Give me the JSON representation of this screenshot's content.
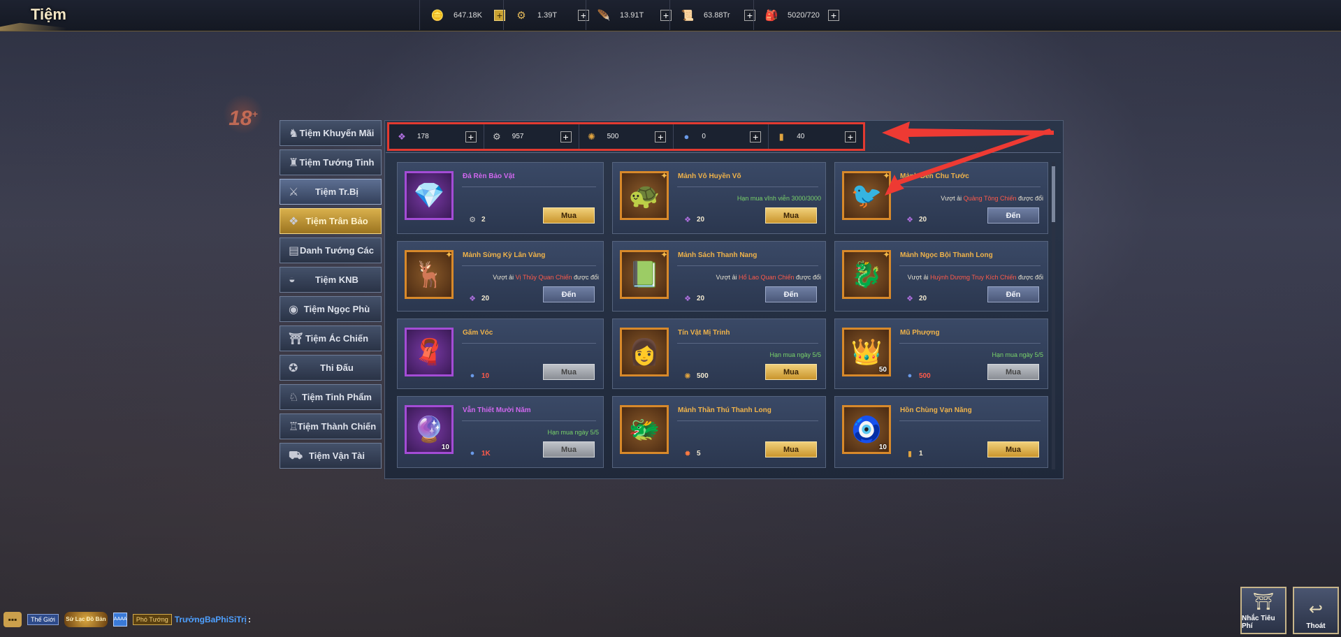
{
  "window": {
    "title": "Tiệm"
  },
  "currencies": [
    {
      "icon": "gold-ingot-icon",
      "glyph": "🪙",
      "value": "647.18K",
      "gold_plus": true
    },
    {
      "icon": "silver-coin-icon",
      "glyph": "⚙",
      "value": "1.39T",
      "gold_plus": false
    },
    {
      "icon": "feather-token-icon",
      "glyph": "🪶",
      "value": "13.91T",
      "gold_plus": false
    },
    {
      "icon": "scroll-token-icon",
      "glyph": "📜",
      "value": "63.88Tr",
      "gold_plus": false
    },
    {
      "icon": "stamina-icon",
      "glyph": "🎒",
      "value": "5020/720",
      "gold_plus": false
    }
  ],
  "age_rating": "18",
  "sidebar": {
    "items": [
      {
        "label": "Tiệm Khuyến Mãi",
        "icon": "horse-icon",
        "glyph": "♞",
        "state": "normal"
      },
      {
        "label": "Tiệm Tướng Tinh",
        "icon": "warrior-icon",
        "glyph": "♜",
        "state": "normal"
      },
      {
        "label": "Tiệm Tr.Bị",
        "icon": "armor-icon",
        "glyph": "⚔",
        "state": "highlight"
      },
      {
        "label": "Tiệm Trân Bảo",
        "icon": "treasure-icon",
        "glyph": "❖",
        "state": "selected"
      },
      {
        "label": "Danh Tướng Các",
        "icon": "book-icon",
        "glyph": "▤",
        "state": "normal"
      },
      {
        "label": "Tiệm KNB",
        "icon": "ingot-icon",
        "glyph": "◒",
        "state": "normal"
      },
      {
        "label": "Tiệm Ngọc Phù",
        "icon": "jade-icon",
        "glyph": "◉",
        "state": "normal"
      },
      {
        "label": "Tiệm Ác Chiến",
        "icon": "pagoda-icon",
        "glyph": "⛩",
        "state": "normal"
      },
      {
        "label": "Thi Đấu",
        "icon": "medal-icon",
        "glyph": "✪",
        "state": "normal"
      },
      {
        "label": "Tiệm Tinh Phẩm",
        "icon": "camel-icon",
        "glyph": "♘",
        "state": "normal"
      },
      {
        "label": "Tiệm Thành Chiến",
        "icon": "castle-icon",
        "glyph": "♖",
        "state": "normal"
      },
      {
        "label": "Tiệm Vận Tài",
        "icon": "cart-icon",
        "glyph": "⛟",
        "state": "normal"
      }
    ]
  },
  "shop_currencies": [
    {
      "icon": "purple-gem-icon",
      "glyph": "❖",
      "color": "#b070e0",
      "value": "178"
    },
    {
      "icon": "silver-coin-icon",
      "glyph": "⚙",
      "color": "#c8c8c8",
      "value": "957"
    },
    {
      "icon": "gold-pouch-icon",
      "glyph": "✺",
      "color": "#e0a440",
      "value": "500"
    },
    {
      "icon": "blue-orb-icon",
      "glyph": "●",
      "color": "#6a9ae8",
      "value": "0"
    },
    {
      "icon": "scroll-token-icon",
      "glyph": "▮",
      "color": "#e0a440",
      "value": "40"
    }
  ],
  "items": [
    {
      "name": "Đá Rèn Bảo Vật",
      "name_color": "pu",
      "frame": "p",
      "glyph": "💎",
      "count": "",
      "star": false,
      "note_pre": "",
      "note_mid": "",
      "note_post": "",
      "note_style": "",
      "price_icon": "silver-coin-icon",
      "price_glyph": "⚙",
      "price_color": "#c8c8c8",
      "price": "2",
      "price_red": false,
      "button": "Mua",
      "button_type": "buy"
    },
    {
      "name": "Mảnh Vô Huyền Võ",
      "name_color": "or",
      "frame": "o",
      "glyph": "🐢",
      "count": "",
      "star": true,
      "note_pre": "Hạn mua vĩnh viễn 3000/3000",
      "note_mid": "",
      "note_post": "",
      "note_style": "g",
      "price_icon": "purple-gem-icon",
      "price_glyph": "❖",
      "price_color": "#b070e0",
      "price": "20",
      "price_red": false,
      "button": "Mua",
      "button_type": "buy"
    },
    {
      "name": "Mảnh Đèn Chu Tước",
      "name_color": "or",
      "frame": "o",
      "glyph": "🐦",
      "count": "",
      "star": true,
      "note_pre": "Vượt ải ",
      "note_mid": "Quảng Tông Chiến",
      "note_post": " được đổi",
      "note_style": "r",
      "price_icon": "purple-gem-icon",
      "price_glyph": "❖",
      "price_color": "#b070e0",
      "price": "20",
      "price_red": false,
      "button": "Đến",
      "button_type": "go"
    },
    {
      "name": "Mảnh Sừng Kỳ Lân Vàng",
      "name_color": "or",
      "frame": "o",
      "glyph": "🦌",
      "count": "",
      "star": true,
      "note_pre": "Vượt ải ",
      "note_mid": "Vị Thủy Quan Chiến",
      "note_post": " được đổi",
      "note_style": "r",
      "price_icon": "purple-gem-icon",
      "price_glyph": "❖",
      "price_color": "#b070e0",
      "price": "20",
      "price_red": false,
      "button": "Đến",
      "button_type": "go"
    },
    {
      "name": "Mảnh Sách Thanh Nang",
      "name_color": "or",
      "frame": "o",
      "glyph": "📗",
      "count": "",
      "star": true,
      "note_pre": "Vượt ải ",
      "note_mid": "Hổ Lao Quan Chiến",
      "note_post": " được đổi",
      "note_style": "r",
      "price_icon": "purple-gem-icon",
      "price_glyph": "❖",
      "price_color": "#b070e0",
      "price": "20",
      "price_red": false,
      "button": "Đến",
      "button_type": "go"
    },
    {
      "name": "Mảnh Ngọc Bội Thanh Long",
      "name_color": "or",
      "frame": "o",
      "glyph": "🐉",
      "count": "",
      "star": true,
      "note_pre": "Vượt ải ",
      "note_mid": "Huỳnh Dương Truy Kích Chiến",
      "note_post": " được đổi",
      "note_style": "r",
      "price_icon": "purple-gem-icon",
      "price_glyph": "❖",
      "price_color": "#b070e0",
      "price": "20",
      "price_red": false,
      "button": "Đến",
      "button_type": "go"
    },
    {
      "name": "Gấm Vóc",
      "name_color": "or",
      "frame": "p",
      "glyph": "🧣",
      "count": "",
      "star": false,
      "note_pre": "",
      "note_mid": "",
      "note_post": "",
      "note_style": "",
      "price_icon": "blue-orb-icon",
      "price_glyph": "●",
      "price_color": "#6a9ae8",
      "price": "10",
      "price_red": true,
      "button": "Mua",
      "button_type": "dis"
    },
    {
      "name": "Tín Vật Mị Trinh",
      "name_color": "or",
      "frame": "o",
      "glyph": "👩",
      "count": "",
      "star": false,
      "note_pre": "Hạn mua ngày 5/5",
      "note_mid": "",
      "note_post": "",
      "note_style": "g",
      "price_icon": "gold-pouch-icon",
      "price_glyph": "✺",
      "price_color": "#e0a440",
      "price": "500",
      "price_red": false,
      "button": "Mua",
      "button_type": "buy"
    },
    {
      "name": "Mũ Phượng",
      "name_color": "or",
      "frame": "o",
      "glyph": "👑",
      "count": "50",
      "star": false,
      "note_pre": "Hạn mua ngày 5/5",
      "note_mid": "",
      "note_post": "",
      "note_style": "g",
      "price_icon": "blue-orb-icon",
      "price_glyph": "●",
      "price_color": "#6a9ae8",
      "price": "500",
      "price_red": true,
      "button": "Mua",
      "button_type": "dis"
    },
    {
      "name": "Vẫn Thiết Mười Năm",
      "name_color": "pu",
      "frame": "p",
      "glyph": "🔮",
      "count": "10",
      "star": false,
      "note_pre": "Hạn mua ngày 5/5",
      "note_mid": "",
      "note_post": "",
      "note_style": "g",
      "price_icon": "blue-orb-icon",
      "price_glyph": "●",
      "price_color": "#6a9ae8",
      "price": "1K",
      "price_red": true,
      "button": "Mua",
      "button_type": "dis"
    },
    {
      "name": "Mảnh Thần Thú Thanh Long",
      "name_color": "or",
      "frame": "o",
      "glyph": "🐲",
      "count": "",
      "star": false,
      "note_pre": "",
      "note_mid": "",
      "note_post": "",
      "note_style": "",
      "price_icon": "fire-gem-icon",
      "price_glyph": "✹",
      "price_color": "#ff7a40",
      "price": "5",
      "price_red": false,
      "button": "Mua",
      "button_type": "buy"
    },
    {
      "name": "Hồn Chùng Vạn Năng",
      "name_color": "or",
      "frame": "o",
      "glyph": "🧿",
      "count": "10",
      "star": false,
      "note_pre": "",
      "note_mid": "",
      "note_post": "",
      "note_style": "",
      "price_icon": "scroll-token-icon",
      "price_glyph": "▮",
      "price_color": "#e0a440",
      "price": "1",
      "price_red": false,
      "button": "Mua",
      "button_type": "buy"
    }
  ],
  "chat": {
    "channel": "Thế Giới",
    "server_logo": "Sử Lạc Đồ Bản",
    "mini": "AAAA",
    "rank": "Phó Tướng",
    "player": "TrưởngBaPhiSiTrị",
    "suffix": ":"
  },
  "bottom_buttons": {
    "remind_label": "Nhắc Tiêu Phí",
    "exit_label": "Thoát"
  }
}
